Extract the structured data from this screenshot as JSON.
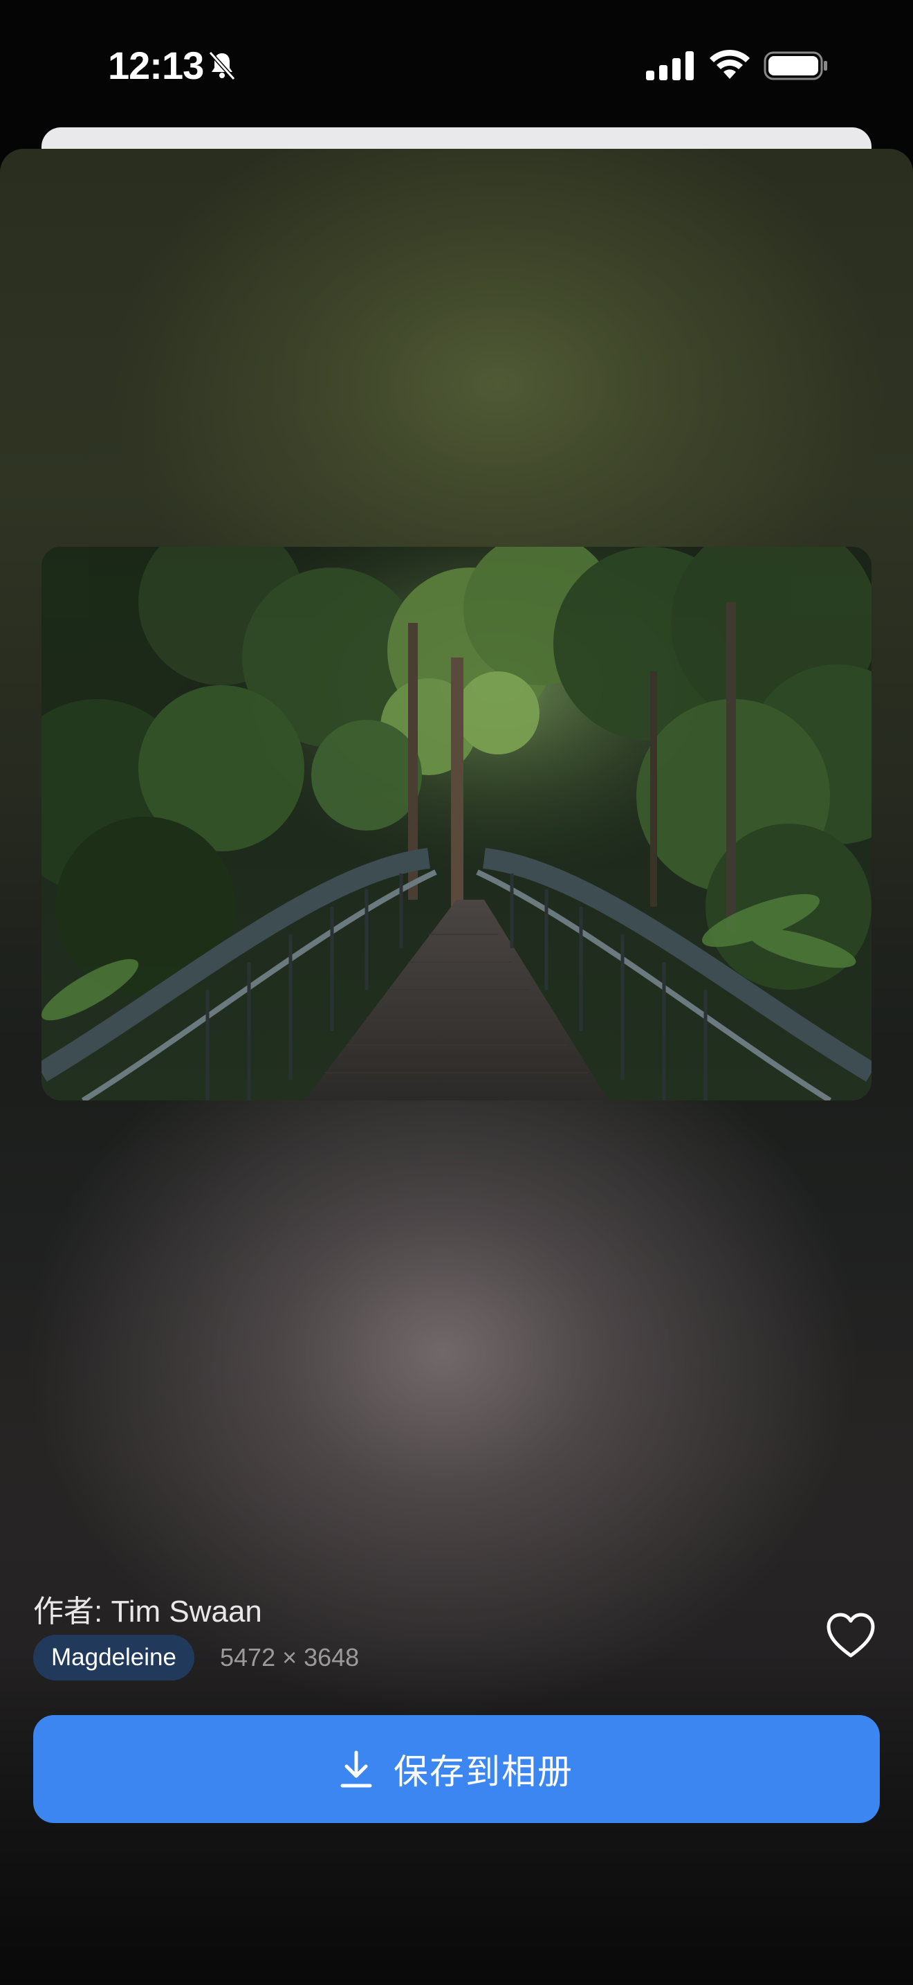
{
  "status_bar": {
    "time": "12:13"
  },
  "photo": {
    "description_icon": "photo-forest-bridge"
  },
  "info": {
    "author": "作者: Tim Swaan",
    "source": "Magdeleine",
    "dimensions": "5472 × 3648"
  },
  "actions": {
    "save_label": "保存到相册",
    "favorite_icon": "heart-icon",
    "save_icon": "download-icon"
  },
  "colors": {
    "accent": "#3b86f0",
    "badge": "#213a5c"
  }
}
